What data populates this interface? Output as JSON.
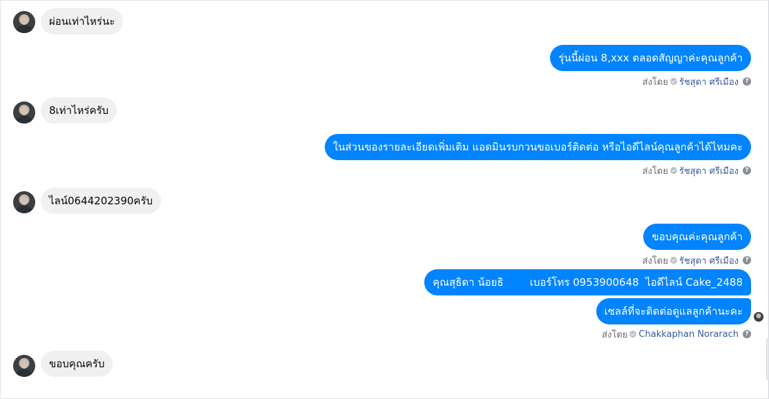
{
  "messages": {
    "m1_in": "ผ่อนเท่าไหร่นะ",
    "m2_out": "รุ่นนี้ผ่อน 8,xxx ตลอดสัญญาค่ะคุณลูกค้า",
    "m3_in": "8เท่าไหร่ครับ",
    "m4_out": "ในส่วนของรายละเอียดเพิ่มเติม แอดมินรบกวนขอเบอร์ติดต่อ หรือไอดีไลน์คุณลูกค้าได้ไหมคะ",
    "m5_in": "ไลน์0644202390ครับ",
    "m6_out": "ขอบคุณค่ะคุณลูกค้า",
    "m7_out": "คุณสุธิดา น้อยธิ        เบอร์โทร 0953900648  ไอดีไลน์ Cake_2488",
    "m8_out": "เซลล์ที่จะติดต่อดูแลลูกค้านะคะ",
    "m9_in": "ขอบคุณครับ"
  },
  "sent_by": {
    "label": "ส่งโดย",
    "agent_1": "รัชสุดา ศรีเมือง",
    "agent_2": "Chakkaphan Norarach",
    "help_glyph": "?"
  },
  "colors": {
    "outgoing_bubble": "#0084ff",
    "incoming_bubble": "#f0f0f0",
    "sender_name": "#385898"
  },
  "icons": {
    "verified": "check-circle-icon",
    "help": "question-circle-icon"
  }
}
